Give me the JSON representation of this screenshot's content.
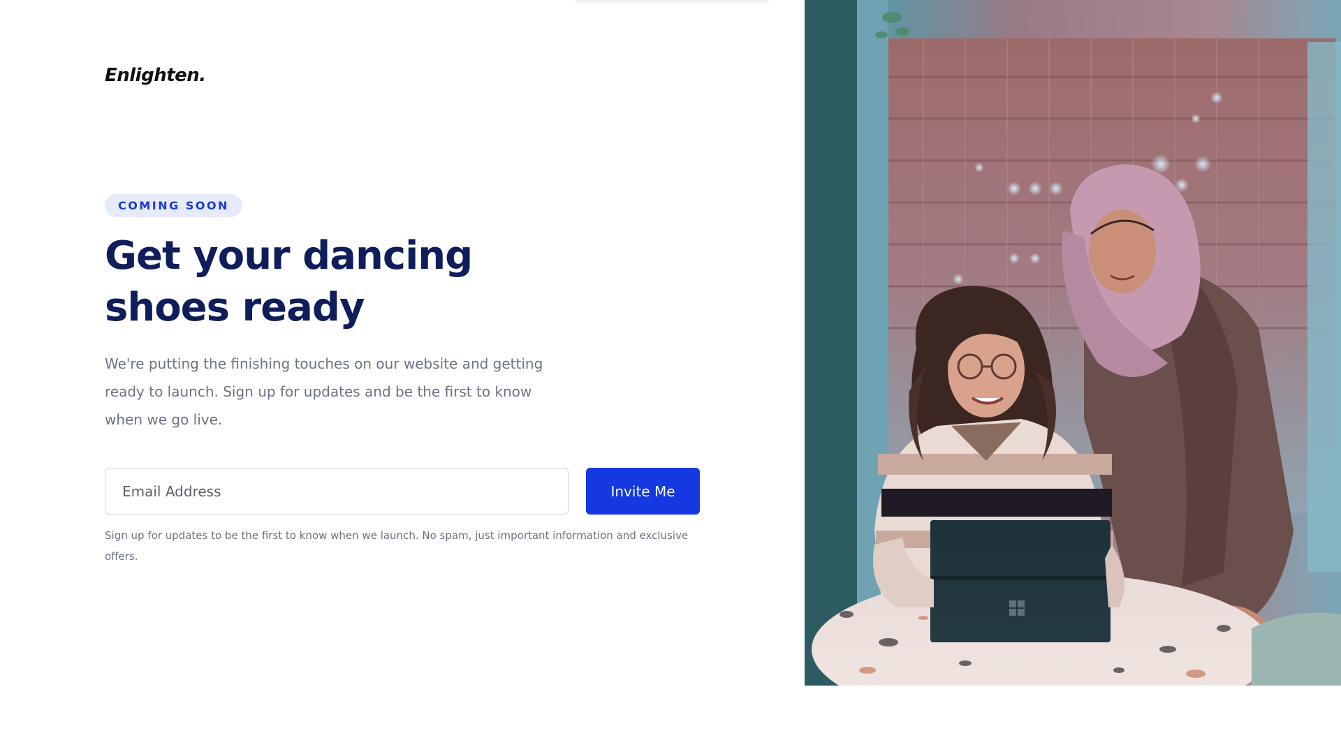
{
  "brand": {
    "logo_text": "Enlighten."
  },
  "hero_text": {
    "badge": "COMING SOON",
    "headline_line1": "Get your dancing",
    "headline_line2": "shoes ready",
    "description_line1": "We're putting the finishing touches on our website and getting",
    "description_line2": "ready to launch. Sign up for updates and be the first to know",
    "description_line3": "when we go live."
  },
  "signup": {
    "email_placeholder": "Email Address",
    "email_value": "",
    "button_label": "Invite Me",
    "disclaimer_line1": "Sign up for updates to be the first to know when we launch. No spam, just important information and exclusive",
    "disclaimer_line2": "offers."
  },
  "colors": {
    "accent": "#1538e0",
    "headline": "#0f1d5a",
    "badge_bg": "#e6ebfb",
    "body_text": "#6b7287"
  }
}
